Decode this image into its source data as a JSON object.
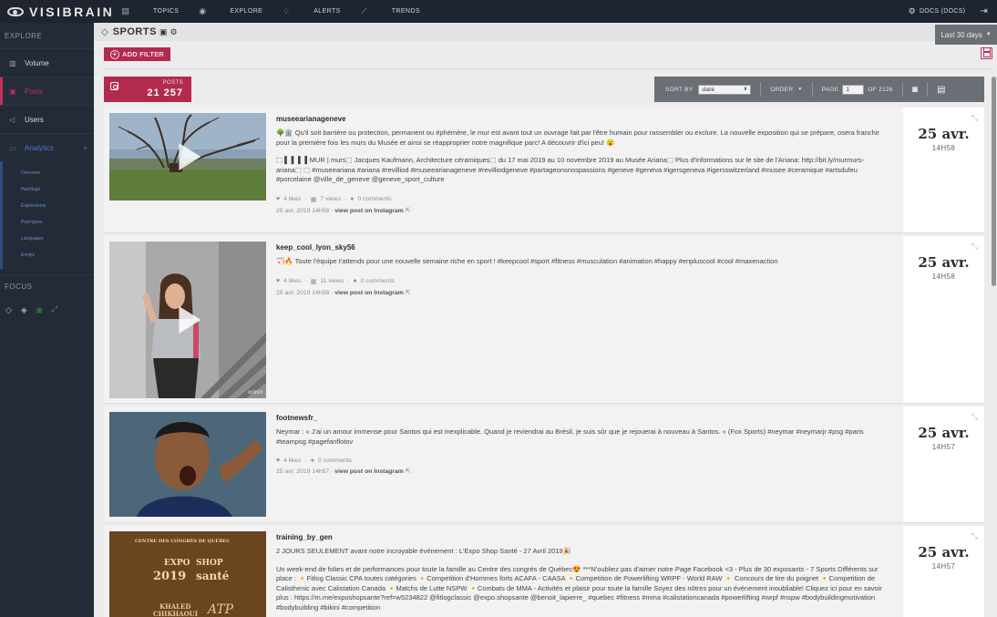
{
  "app": {
    "name": "VISIBRAIN"
  },
  "top_nav": [
    {
      "label": "TOPICS",
      "icon": "document-icon"
    },
    {
      "label": "EXPLORE",
      "icon": "eye-icon"
    },
    {
      "label": "ALERTS",
      "icon": "bell-icon"
    },
    {
      "label": "TRENDS",
      "icon": "line-chart-icon"
    }
  ],
  "user": {
    "label": "DOCS (DOCS)"
  },
  "sidebar": {
    "explore_label": "EXPLORE",
    "items": [
      {
        "label": "Volume",
        "icon": "bar-chart-icon"
      },
      {
        "label": "Posts",
        "icon": "image-icon"
      },
      {
        "label": "Users",
        "icon": "megaphone-icon"
      },
      {
        "label": "Analytics",
        "icon": "chat-icon",
        "plus": "+"
      }
    ],
    "subitems": [
      "Overview",
      "Hashtags",
      "Expressions",
      "Post types",
      "Languages",
      "Emojis"
    ],
    "focus_label": "FOCUS"
  },
  "header": {
    "title": "SPORTS",
    "period": "Last 30 days",
    "add_filter": "ADD FILTER"
  },
  "posts_counter": {
    "label": "POSTS",
    "value": "21 257"
  },
  "toolbar": {
    "sort_by_label": "SORT BY",
    "sort_by_value": "date",
    "order_label": "ORDER",
    "page_label": "PAGE",
    "page_value": "1",
    "of_label": "OF 2126"
  },
  "posts": [
    {
      "user": "museearianageneve",
      "text1": "🌳🏛️ Qu'il soit barrière ou protection, permanent ou éphémère, le mur est avant tout un ouvrage fait par l'être humain pour rassembler ou exclure. La nouvelle exposition qui se prépare, osera franchir pour la première fois les murs du Musée et ainsi se réapproprier notre magnifique parc! A découvrir d'ici peu! 😮",
      "text2": "⬚ ▌ ▌ ▌ ▌MUR | murs⬚ Jacques Kaufmann, Architecture céramiques⬚ du 17 mai 2019 au 10 novembre 2019 au Musée Ariana⬚ Plus d'informations sur le site de l'Ariana: http://bit.ly/murmurs-ariana⬚ ⬚ #museeariana #ariana #revilliod #museearianageneve #revilliodgeneve #partageonsnospassions #geneve #geneva #igersgeneva #igersswitzerland #musee #ceramique #artsdufeu #porcelaine @ville_de_geneve @geneve_sport_culture",
      "likes": "4 likes",
      "views": "7 views",
      "comments": "0 comments",
      "posted": "25 avr. 2019 14h58",
      "link": "view post on Instagram",
      "day": "25 avr.",
      "time": "14H58"
    },
    {
      "user": "keep_cool_lyon_sky56",
      "text1": "🏹🔥 Toute l'équipe t'attends pour une nouvelle semaine riche en sport ! #keepcool #sport #fitness #musculation #animation #happy #enpluscool #cool #maxenaction",
      "text2": "",
      "likes": "4 likes",
      "views": "11 views",
      "comments": "0 comments",
      "posted": "25 avr. 2019 14h58",
      "link": "view post on Instagram",
      "day": "25 avr.",
      "time": "14H58",
      "watermark": "InShOt"
    },
    {
      "user": "footnewsfr_",
      "text1": "Neymar : « J'ai un amour immense pour Santos qui est inexplicable. Quand je reviendrai au Brésil, je suis sûr que je rejouerai à nouveau à Santos. » (Fox Sports) #neymar #neymarjr #psg #paris #teampsg #pagefanflotov",
      "text2": "",
      "likes": "4 likes",
      "views": "",
      "comments": "0 comments",
      "posted": "25 avr. 2019 14h57",
      "link": "view post on Instagram",
      "day": "25 avr.",
      "time": "14H57"
    },
    {
      "user": "training_by_gen",
      "text1": "2 JOURS SEULEMENT avant notre incroyable événement : L'Expo Shop Santé - 27 Avril 2019🎉",
      "text2": "Un week-end de folies et de performances pour toute la famille au Centre des congrès de Québec😍 ***N'oubliez pas d'aimer notre Page Facebook <3 - Plus de 30 exposants - 7 Sports Différents sur place : 🔸Fitlog Classic CPA toutes catégories 🔸Competition d'Hommes forts ACAFA - CAASA 🔸Competition de Powerlifting WRPF - World RAW 🔸 Concours de tire du poignet 🔸Competition de Calisthenic avec Calistation Canada 🔸Matchs de Lutte NSPW 🔸Combats de MMA - Activités et plaisir pour toute la famille Soyez des nôtres pour un événement inoubliable! Cliquez ici pour en savoir plus : https://m.me/exposhopsante?ref=w5234822 @fitlogclassic @expo.shopsante @benoit_lapierre_ #quebec #fitness #mma #calistationcanada #powerlifting #wrpf #nspw #bodybuildingmotivation #bodybuilding #bikini #competition",
      "day": "25 avr.",
      "time": "14H57",
      "poster": {
        "line1": "CENTRE DES CONGRÈS DE QUÉBEC",
        "expo": "EXPO",
        "shop": "SHOP",
        "year": "2019",
        "sante": "santé",
        "name1": "KHALED",
        "name2": "CHIKHAOUI",
        "atp": "ATP"
      }
    }
  ],
  "colors": {
    "accent": "#b32a4f",
    "topbar": "#1e2530",
    "sidebar": "#232b36",
    "analytics": "#4a79c9"
  }
}
